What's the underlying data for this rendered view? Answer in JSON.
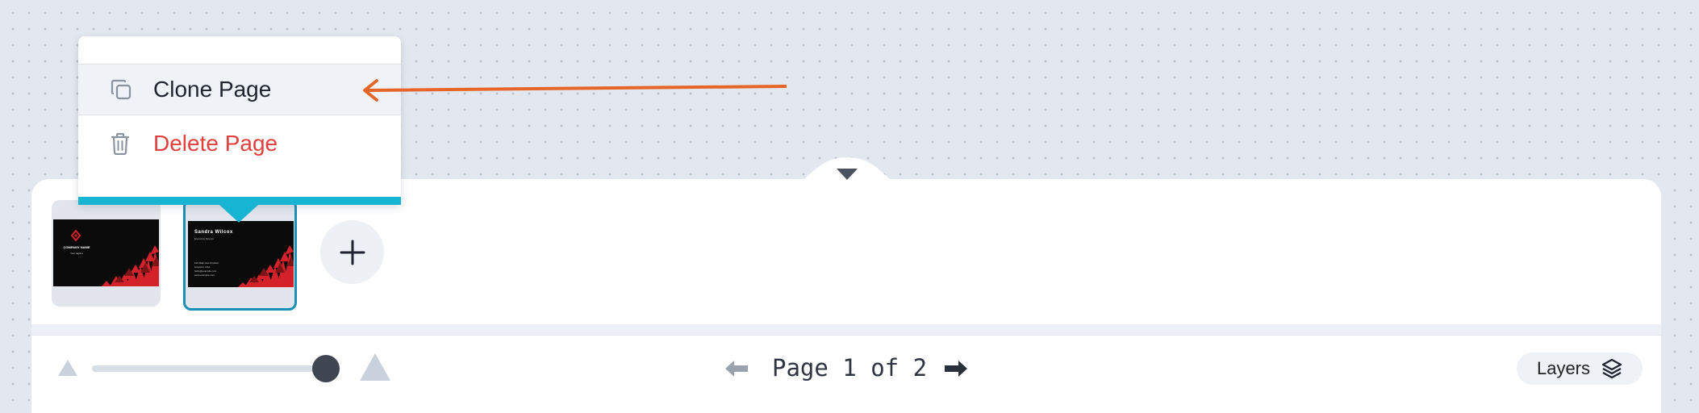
{
  "context_menu": {
    "items": [
      {
        "label": "Clone Page",
        "icon": "copy-icon"
      },
      {
        "label": "Delete Page",
        "icon": "trash-icon"
      }
    ],
    "accent_color": "#18b4d3",
    "delete_color": "#e0403e"
  },
  "pages": {
    "thumbnails": [
      {
        "heading": "COMPANY NAME",
        "subheading": "Your tagline",
        "selected": false
      },
      {
        "heading": "Sandra Wilcox",
        "subheading": "Executive Director",
        "lines": [
          "123 Main Ave Anytown",
          "Anytown, USA",
          "hello@example.com",
          "www.example.com"
        ],
        "selected": true
      }
    ],
    "add_button_icon": "plus-icon"
  },
  "footer": {
    "zoom_level": 0.95,
    "page_label": "Page 1 of 2",
    "current_page": 1,
    "total_pages": 2,
    "layers_label": "Layers",
    "layers_icon": "layers-icon",
    "prev_icon": "arrow-left-icon",
    "next_icon": "arrow-right-icon"
  },
  "annotation_color": "#e8652a"
}
